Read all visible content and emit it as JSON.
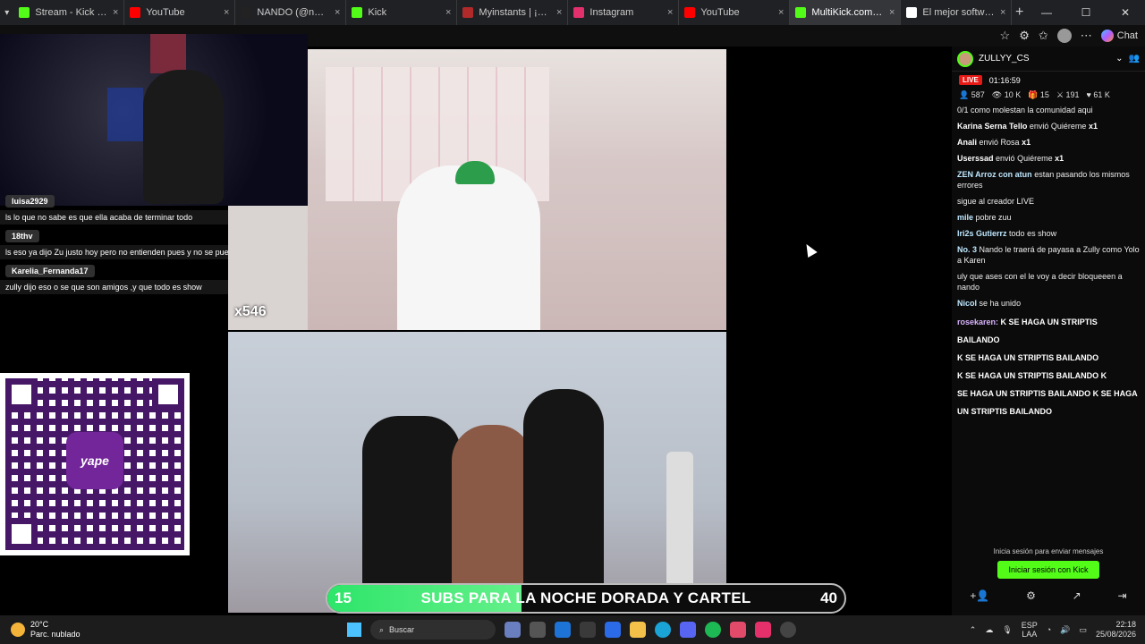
{
  "browser": {
    "tabs": [
      {
        "title": "Stream - Kick Dashboa",
        "color": "#53fc18"
      },
      {
        "title": "YouTube",
        "color": "#ff0000"
      },
      {
        "title": "NANDO (@nandoweed",
        "color": "#222222"
      },
      {
        "title": "Kick",
        "color": "#53fc18"
      },
      {
        "title": "Myinstants | ¡El sitio web",
        "color": "#b02a2a"
      },
      {
        "title": "Instagram",
        "color": "#e1306c"
      },
      {
        "title": "YouTube",
        "color": "#ff0000"
      },
      {
        "title": "MultiKick.com: Wa",
        "color": "#53fc18"
      },
      {
        "title": "El mejor software para p",
        "color": "#ffffff"
      }
    ],
    "chat_label": "Chat",
    "new_tab": "+",
    "close": "×"
  },
  "overlay_chat": [
    {
      "user": "luisa2929",
      "text": "ls lo que no sabe es que ella acaba de terminar todo"
    },
    {
      "user": "18thv",
      "text": "ls eso ya dijo Zu justo hoy pero no entienden pues y no se puede controlar a tantos"
    },
    {
      "user": "Karelia_Fernanda17",
      "text": "zully dijo eso o se que son amigos ,y que todo es show"
    }
  ],
  "overlay": {
    "multiplier": "x546",
    "qr_brand": "yape"
  },
  "subgoal": {
    "current": "15",
    "label": "SUBS PARA LA NOCHE DORADA Y CARTEL",
    "target": "40",
    "progress": 0.375
  },
  "chat": {
    "channel": "ZULLYY_CS",
    "live": "LIVE",
    "uptime": "01:16:59",
    "stats": {
      "viewers": "587",
      "watch": "10 K",
      "gifts": "15",
      "mods": "191",
      "followers": "61 K"
    },
    "messages": [
      {
        "user": "",
        "text": "0/1 como molestan la comunidad aqui"
      },
      {
        "user": "Karina Serna Tello",
        "text": "envió Quiéreme",
        "count": "x1",
        "gift": true
      },
      {
        "user": "Anali",
        "text": "envió Rosa",
        "count": "x1",
        "gift": true
      },
      {
        "user": "Userssad",
        "text": "envió Quiéreme",
        "count": "x1",
        "gift": true
      },
      {
        "user": "ZEN Arroz con atun",
        "text": "estan pasando los mismos errores"
      },
      {
        "user": "",
        "text": "sigue al creador LIVE"
      },
      {
        "user": "mile",
        "text": "pobre zuu"
      },
      {
        "user": "Iri2s Gutierrz",
        "text": "todo es show"
      },
      {
        "user": "No. 3",
        "text": "Nando le traerá de payasa a Zully como Yolo a Karen"
      },
      {
        "user": "",
        "text": "uly que ases con el le voy a decir bloqueeen a nando"
      },
      {
        "user": "Nicol",
        "text": "se ha unido"
      }
    ],
    "highlight_user": "rosekaren:",
    "highlight_lines": [
      "K SE HAGA UN STRIPTIS BAILANDO",
      "K SE HAGA UN STRIPTIS BAILANDO",
      "K SE HAGA UN STRIPTIS BAILANDO K",
      "SE HAGA UN STRIPTIS BAILANDO K SE HAGA",
      "UN STRIPTIS BAILANDO"
    ],
    "login_hint": "Inicia sesión para enviar mensajes",
    "login_button": "Iniciar sesión con Kick"
  },
  "taskbar": {
    "temp": "20°C",
    "weather": "Parc. nublado",
    "search_placeholder": "Buscar",
    "lang": "ESP",
    "layout": "LAA",
    "time": "22:18",
    "date": "25/08/2026"
  }
}
